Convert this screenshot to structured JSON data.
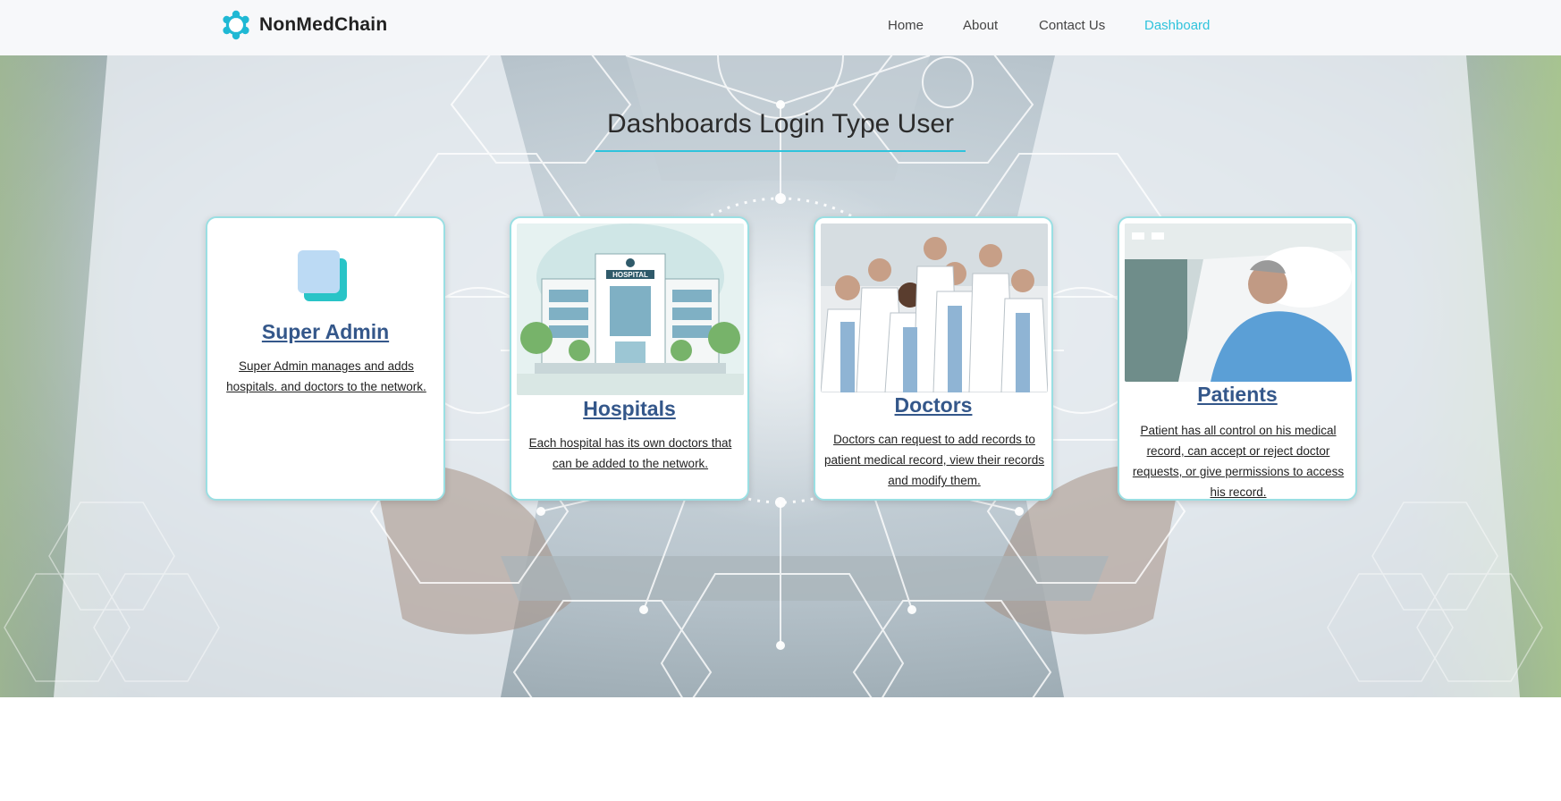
{
  "brand": {
    "name": "NonMedChain",
    "logo_icon": "ring-logo-icon",
    "accent": "#2fc3dc"
  },
  "nav": {
    "items": [
      {
        "label": "Home",
        "active": false
      },
      {
        "label": "About",
        "active": false
      },
      {
        "label": "Contact Us",
        "active": false
      },
      {
        "label": "Dashboard",
        "active": true
      }
    ]
  },
  "hero": {
    "title": "Dashboards Login Type User",
    "background": "doctor-holding-tablet-with-medical-hexagon-icons"
  },
  "cards": [
    {
      "title": "Super Admin",
      "description": "Super Admin manages and adds hospitals. and doctors to the network.",
      "icon": "copy-squares-icon"
    },
    {
      "title": "Hospitals",
      "description": "Each hospital has its own doctors that can be added to the network.",
      "image_label": "HOSPITAL"
    },
    {
      "title": "Doctors",
      "description": "Doctors can request to add records to patient medical record, view their records and modify them."
    },
    {
      "title": "Patients",
      "description": "Patient has all control on his medical record, can accept or reject doctor requests, or give permissions to access his record."
    }
  ]
}
